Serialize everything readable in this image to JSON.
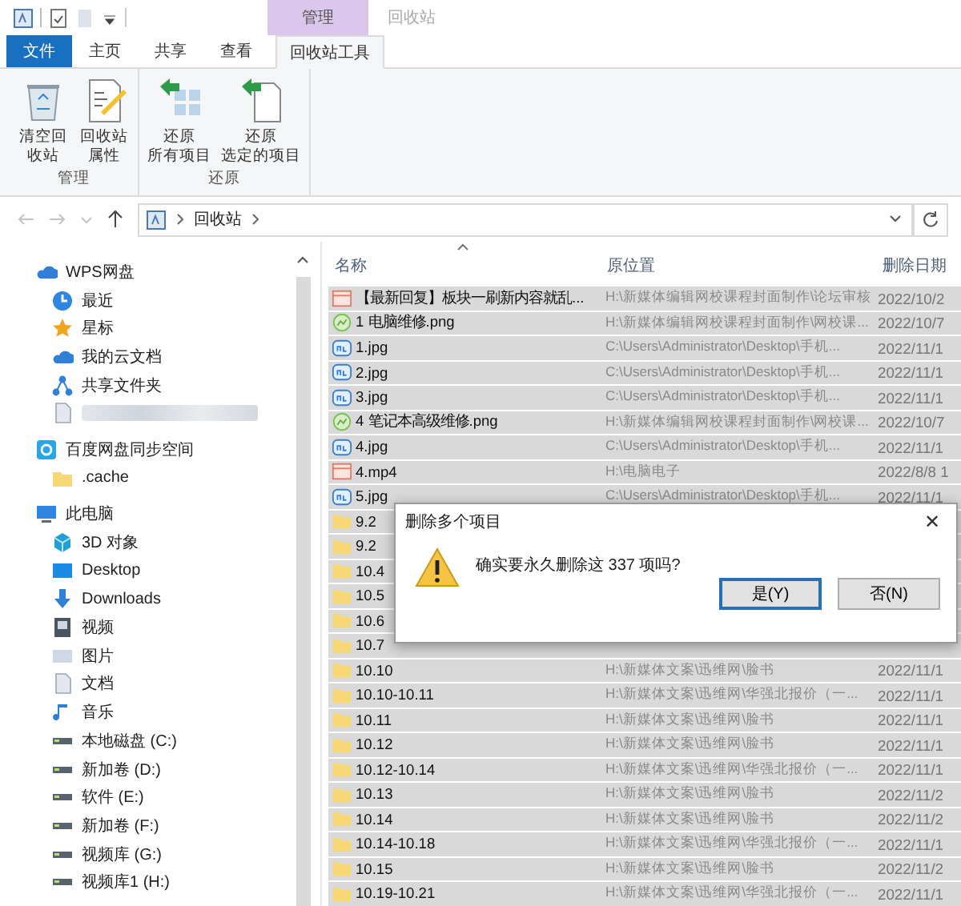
{
  "window": {
    "context_tab": "管理",
    "title": "回收站"
  },
  "tabs": [
    {
      "label": "文件",
      "kind": "file",
      "selected": false
    },
    {
      "label": "主页",
      "kind": "normal",
      "selected": false
    },
    {
      "label": "共享",
      "kind": "normal",
      "selected": false
    },
    {
      "label": "查看",
      "kind": "normal",
      "selected": false
    },
    {
      "label": "回收站工具",
      "kind": "context",
      "selected": true
    }
  ],
  "ribbon_groups": [
    {
      "label": "管理",
      "buttons": [
        {
          "lines": [
            "清空回",
            "收站"
          ],
          "kind": "bin"
        },
        {
          "lines": [
            "回收站",
            "属性"
          ],
          "kind": "props"
        }
      ]
    },
    {
      "label": "还原",
      "buttons": [
        {
          "lines": [
            "还原",
            "所有项目"
          ],
          "kind": "restore-all"
        },
        {
          "lines": [
            "还原",
            "选定的项目"
          ],
          "kind": "restore-one"
        }
      ]
    }
  ],
  "address": {
    "path": [
      "回收站"
    ]
  },
  "nav": [
    {
      "label": "WPS网盘",
      "kind": "cloud",
      "children": [
        {
          "label": "最近",
          "kind": "clock"
        },
        {
          "label": "星标",
          "kind": "star"
        },
        {
          "label": "我的云文档",
          "kind": "cloud"
        },
        {
          "label": "共享文件夹",
          "kind": "share"
        },
        {
          "kind": "redacted"
        }
      ]
    },
    {
      "label": "百度网盘同步空间",
      "kind": "sync",
      "children": [
        {
          "label": ".cache",
          "kind": "folder"
        }
      ]
    },
    {
      "label": "此电脑",
      "kind": "pc",
      "children": [
        {
          "label": "3D 对象",
          "kind": "cube"
        },
        {
          "label": "Desktop",
          "kind": "desktop"
        },
        {
          "label": "Downloads",
          "kind": "download"
        },
        {
          "label": "视频",
          "kind": "video"
        },
        {
          "label": "图片",
          "kind": "pics"
        },
        {
          "label": "文档",
          "kind": "doc"
        },
        {
          "label": "音乐",
          "kind": "music"
        },
        {
          "label": "本地磁盘 (C:)",
          "kind": "drive"
        },
        {
          "label": "新加卷 (D:)",
          "kind": "drive"
        },
        {
          "label": "软件 (E:)",
          "kind": "drive"
        },
        {
          "label": "新加卷 (F:)",
          "kind": "drive"
        },
        {
          "label": "视频库 (G:)",
          "kind": "drive"
        },
        {
          "label": "视频库1 (H:)",
          "kind": "drive"
        }
      ]
    }
  ],
  "table": {
    "columns": [
      {
        "label": "名称",
        "sorted": true
      },
      {
        "label": "原位置",
        "sorted": false
      },
      {
        "label": "删除日期",
        "sorted": false
      }
    ],
    "rows": [
      {
        "kind": "html",
        "name": "【最新回复】板块一刷新内容就乱...",
        "location": "H:\\新媒体编辑网校课程封面制作\\论坛审核",
        "date": "2022/10/2",
        "selected": true
      },
      {
        "kind": "png",
        "name": "1 电脑维修.png",
        "location": "H:\\新媒体编辑网校课程封面制作\\网校课...",
        "date": "2022/10/7",
        "selected": true
      },
      {
        "kind": "jpg",
        "name": "1.jpg",
        "location": "C:\\Users\\Administrator\\Desktop\\手机...",
        "date": "2022/11/1",
        "selected": true
      },
      {
        "kind": "jpg",
        "name": "2.jpg",
        "location": "C:\\Users\\Administrator\\Desktop\\手机...",
        "date": "2022/11/1",
        "selected": true
      },
      {
        "kind": "jpg",
        "name": "3.jpg",
        "location": "C:\\Users\\Administrator\\Desktop\\手机...",
        "date": "2022/11/1",
        "selected": true
      },
      {
        "kind": "png",
        "name": "4 笔记本高级维修.png",
        "location": "H:\\新媒体编辑网校课程封面制作\\网校课...",
        "date": "2022/10/7",
        "selected": true
      },
      {
        "kind": "jpg",
        "name": "4.jpg",
        "location": "C:\\Users\\Administrator\\Desktop\\手机...",
        "date": "2022/11/1",
        "selected": true
      },
      {
        "kind": "mp4",
        "name": "4.mp4",
        "location": "H:\\电脑电子",
        "date": "2022/8/8 1",
        "selected": true
      },
      {
        "kind": "jpg",
        "name": "5.jpg",
        "location": "C:\\Users\\Administrator\\Desktop\\手机...",
        "date": "2022/11/1",
        "selected": true
      },
      {
        "kind": "folder",
        "name": "9.2",
        "selected": true
      },
      {
        "kind": "folder",
        "name": "9.2",
        "selected": true
      },
      {
        "kind": "folder",
        "name": "10.4",
        "selected": true
      },
      {
        "kind": "folder",
        "name": "10.5",
        "selected": true
      },
      {
        "kind": "folder",
        "name": "10.6",
        "selected": true
      },
      {
        "kind": "folder",
        "name": "10.7",
        "selected": true
      },
      {
        "kind": "folder",
        "name": "10.10",
        "location": "H:\\新媒体文案\\迅维网\\脸书",
        "date": "2022/11/1",
        "selected": true
      },
      {
        "kind": "folder",
        "name": "10.10-10.11",
        "location": "H:\\新媒体文案\\迅维网\\华强北报价（一...",
        "date": "2022/11/1",
        "selected": true
      },
      {
        "kind": "folder",
        "name": "10.11",
        "location": "H:\\新媒体文案\\迅维网\\脸书",
        "date": "2022/11/1",
        "selected": true
      },
      {
        "kind": "folder",
        "name": "10.12",
        "location": "H:\\新媒体文案\\迅维网\\脸书",
        "date": "2022/11/1",
        "selected": true
      },
      {
        "kind": "folder",
        "name": "10.12-10.14",
        "location": "H:\\新媒体文案\\迅维网\\华强北报价（一...",
        "date": "2022/11/1",
        "selected": true
      },
      {
        "kind": "folder",
        "name": "10.13",
        "location": "H:\\新媒体文案\\迅维网\\脸书",
        "date": "2022/11/2",
        "selected": true
      },
      {
        "kind": "folder",
        "name": "10.14",
        "location": "H:\\新媒体文案\\迅维网\\脸书",
        "date": "2022/11/2",
        "selected": true
      },
      {
        "kind": "folder",
        "name": "10.14-10.18",
        "location": "H:\\新媒体文案\\迅维网\\华强北报价（一...",
        "date": "2022/11/1",
        "selected": true
      },
      {
        "kind": "folder",
        "name": "10.15",
        "location": "H:\\新媒体文案\\迅维网\\脸书",
        "date": "2022/11/2",
        "selected": true
      },
      {
        "kind": "folder",
        "name": "10.19-10.21",
        "location": "H:\\新媒体文案\\迅维网\\华强北报价（一...",
        "date": "2022/11/1",
        "selected": true
      }
    ]
  },
  "dialog": {
    "title": "删除多个项目",
    "close": "✕",
    "message": "确实要永久删除这 337 项吗?",
    "buttons": [
      {
        "label": "是(Y)",
        "default": true
      },
      {
        "label": "否(N)",
        "default": false
      }
    ]
  }
}
